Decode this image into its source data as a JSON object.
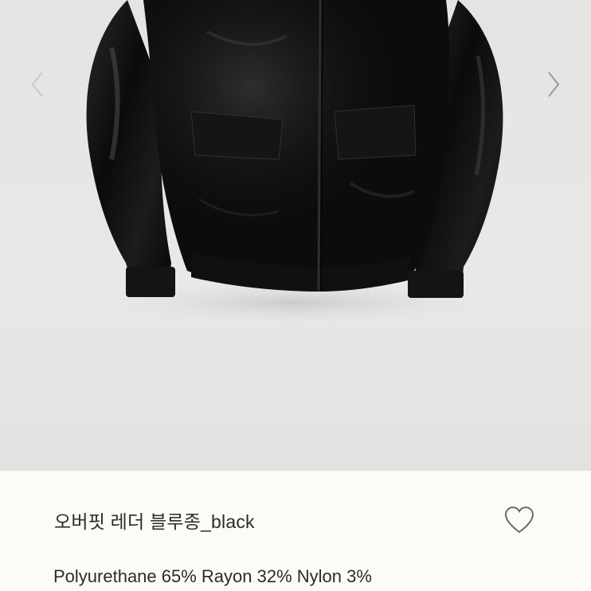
{
  "product": {
    "title": "오버핏 레더 블루종_black",
    "material": "Polyurethane 65% Rayon 32% Nylon 3%"
  },
  "icons": {
    "prev": "chevron-left-icon",
    "next": "chevron-right-icon",
    "like": "heart-outline-icon"
  },
  "colors": {
    "background": "#e6e6e4",
    "jacket": "#0d0d0d",
    "text": "#2b2b2b"
  }
}
